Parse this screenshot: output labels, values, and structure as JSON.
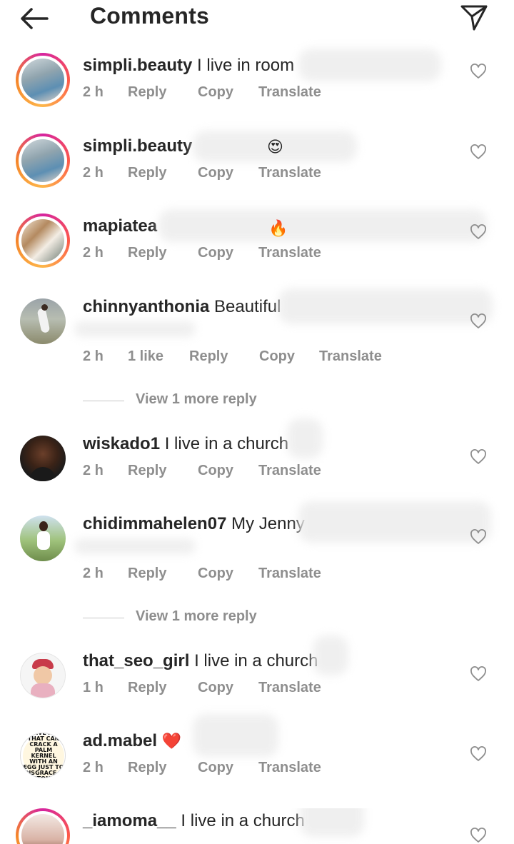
{
  "header": {
    "title": "Comments",
    "back_icon": "arrow-left-icon",
    "send_icon": "paper-plane-icon"
  },
  "colors": {
    "text": "#262626",
    "secondary": "#8e8e8e",
    "ring_start": "#d6249f",
    "ring_end": "#fdb64b",
    "heart_red": "#ed1c24"
  },
  "comments": [
    {
      "username": "simpli.beauty",
      "text": "I live in room",
      "emoji": "",
      "time": "2 h",
      "likes": "",
      "reply": "Reply",
      "copy": "Copy",
      "translate": "Translate"
    },
    {
      "username": "simpli.beauty",
      "text": "",
      "emoji": "😍",
      "time": "2 h",
      "likes": "",
      "reply": "Reply",
      "copy": "Copy",
      "translate": "Translate"
    },
    {
      "username": "mapiatea",
      "text": "",
      "emoji": "🔥",
      "time": "2 h",
      "likes": "",
      "reply": "Reply",
      "copy": "Copy",
      "translate": "Translate"
    },
    {
      "username": "chinnyanthonia",
      "text": "Beautiful",
      "emoji": "",
      "time": "2 h",
      "likes": "1 like",
      "reply": "Reply",
      "copy": "Copy",
      "translate": "Translate"
    },
    {
      "username": "wiskado1",
      "text": "I live in a church",
      "emoji": "",
      "time": "2 h",
      "likes": "",
      "reply": "Reply",
      "copy": "Copy",
      "translate": "Translate"
    },
    {
      "username": "chidimmahelen07",
      "text": "My Jenny",
      "emoji": "",
      "time": "2 h",
      "likes": "",
      "reply": "Reply",
      "copy": "Copy",
      "translate": "Translate"
    },
    {
      "username": "that_seo_girl",
      "text": "I live in a church",
      "emoji": "",
      "time": "1 h",
      "likes": "",
      "reply": "Reply",
      "copy": "Copy",
      "translate": "Translate"
    },
    {
      "username": "ad.mabel",
      "text": "",
      "emoji": "❤️",
      "time": "2 h",
      "likes": "",
      "reply": "Reply",
      "copy": "Copy",
      "translate": "Translate",
      "avatar_text": "SERVE A GI THAT CAN CRACK A PALM KERNEL WITH AN EGG JUST TO DISGRACE A STONE"
    },
    {
      "username": "_iamoma__",
      "text": "I live in a church",
      "emoji": "",
      "time": "",
      "likes": "",
      "reply": "",
      "copy": "",
      "translate": ""
    }
  ],
  "view_more": [
    {
      "label": "View 1 more reply"
    },
    {
      "label": "View 1 more reply"
    }
  ]
}
